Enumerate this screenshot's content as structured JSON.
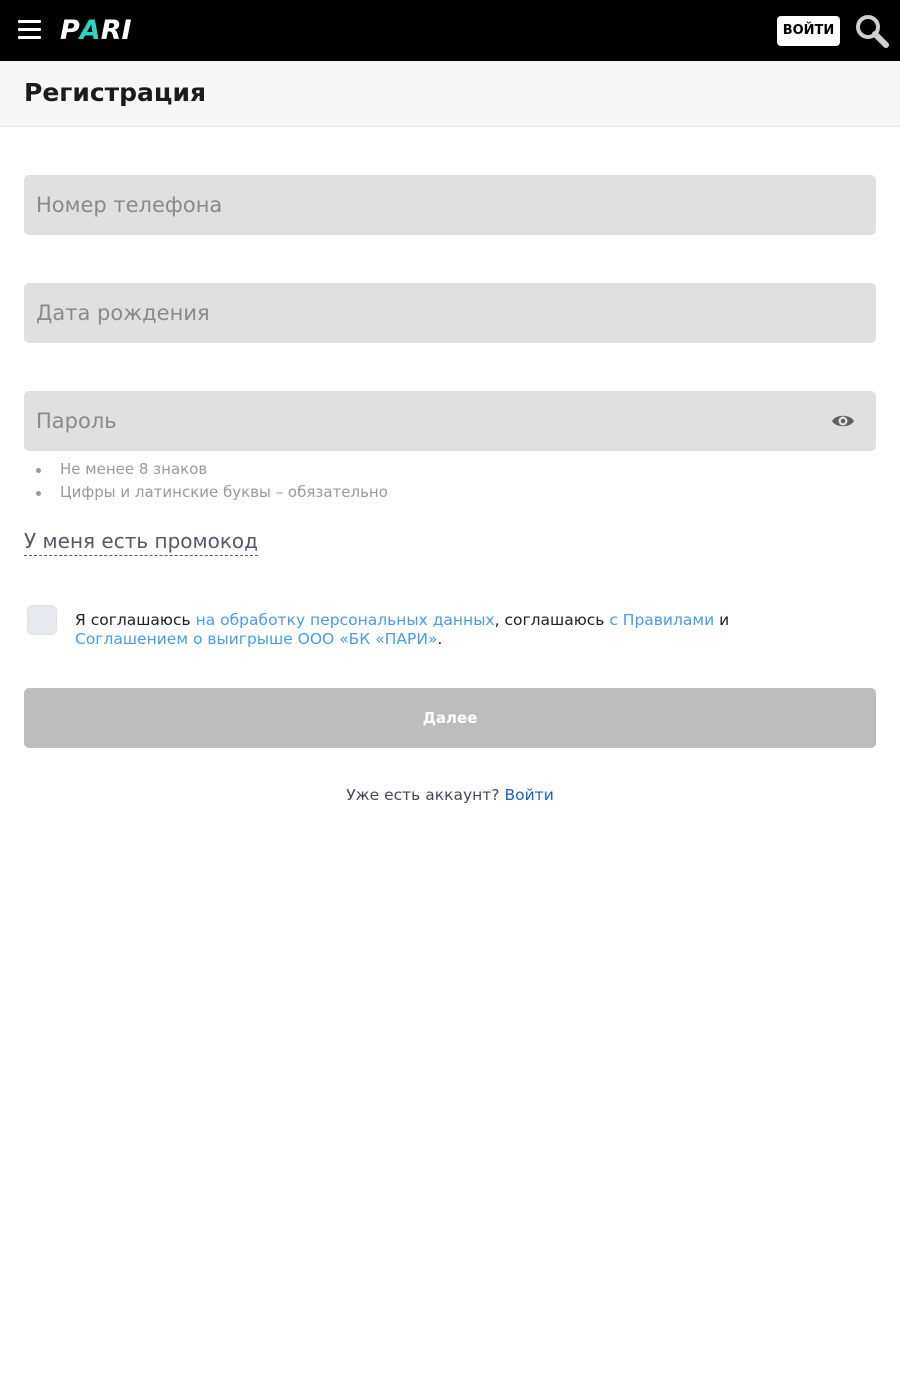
{
  "header": {
    "logo_parts": [
      "P",
      "A",
      "RI"
    ],
    "login_label": "ВОЙТИ",
    "brand_color": "#000000",
    "logo_accent_color": "#2dd4bf"
  },
  "page": {
    "title": "Регистрация"
  },
  "form": {
    "phone_placeholder": "Номер телефона",
    "birthdate_placeholder": "Дата рождения",
    "password_placeholder": "Пароль",
    "password_hints": [
      "Не менее 8 знаков",
      "Цифры и латинские буквы – обязательно"
    ],
    "promo_link": "У меня есть промокод",
    "agreement": {
      "checked": false,
      "text_1": "Я соглашаюсь ",
      "link_1": "на обработку персональных данных",
      "text_2": ", соглашаюсь ",
      "link_2": "с Правилами",
      "text_3": " и ",
      "link_3": "Соглашением о выигрыше ООО «БК «ПАРИ»",
      "text_4": "."
    },
    "submit_label": "Далее",
    "link_color": "#4a9be6"
  },
  "footer": {
    "account_text": "Уже есть аккаунт?",
    "login_link": "Войти"
  }
}
